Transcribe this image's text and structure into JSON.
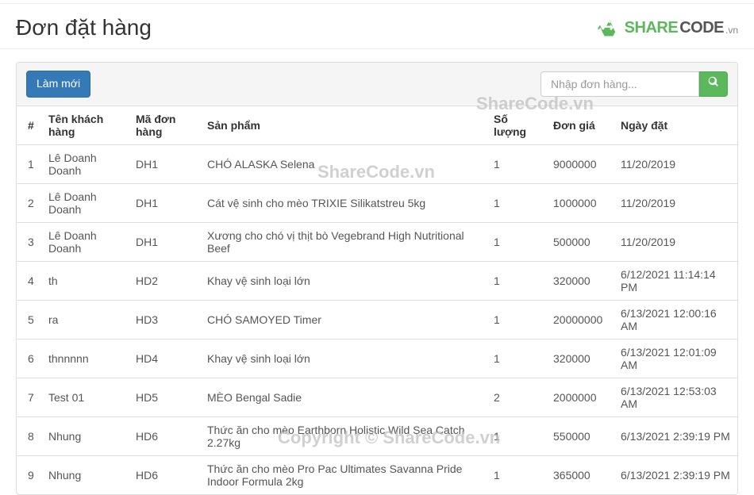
{
  "header": {
    "title": "Đơn đặt hàng",
    "logo": {
      "share": "SHARE",
      "code": "CODE",
      "vn": ".vn"
    }
  },
  "toolbar": {
    "refresh_label": "Làm mới",
    "search_placeholder": "Nhập đơn hàng..."
  },
  "table": {
    "headers": {
      "idx": "#",
      "customer": "Tên khách hàng",
      "order_code": "Mã đơn hàng",
      "product": "Sản phẩm",
      "qty": "Số lượng",
      "price": "Đơn giá",
      "date": "Ngày đặt"
    },
    "rows": [
      {
        "idx": "1",
        "customer": "Lê Doanh Doanh",
        "order_code": "DH1",
        "product": "CHÓ ALASKA Selena",
        "qty": "1",
        "price": "9000000",
        "date": "11/20/2019"
      },
      {
        "idx": "2",
        "customer": "Lê Doanh Doanh",
        "order_code": "DH1",
        "product": "Cát vệ sinh cho mèo TRIXIE Silikatstreu 5kg",
        "qty": "1",
        "price": "1000000",
        "date": "11/20/2019"
      },
      {
        "idx": "3",
        "customer": "Lê Doanh Doanh",
        "order_code": "DH1",
        "product": "Xương cho chó vị thịt bò Vegebrand High Nutritional Beef",
        "qty": "1",
        "price": "500000",
        "date": "11/20/2019"
      },
      {
        "idx": "4",
        "customer": "th",
        "order_code": "HD2",
        "product": "Khay vệ sinh loại lớn",
        "qty": "1",
        "price": "320000",
        "date": "6/12/2021 11:14:14 PM"
      },
      {
        "idx": "5",
        "customer": "ra",
        "order_code": "HD3",
        "product": "CHÓ SAMOYED Timer",
        "qty": "1",
        "price": "20000000",
        "date": "6/13/2021 12:00:16 AM"
      },
      {
        "idx": "6",
        "customer": "thnnnnn",
        "order_code": "HD4",
        "product": "Khay vệ sinh loại lớn",
        "qty": "1",
        "price": "320000",
        "date": "6/13/2021 12:01:09 AM"
      },
      {
        "idx": "7",
        "customer": "Test 01",
        "order_code": "HD5",
        "product": "MÈO Bengal Sadie",
        "qty": "2",
        "price": "2000000",
        "date": "6/13/2021 12:53:03 AM"
      },
      {
        "idx": "8",
        "customer": "Nhung",
        "order_code": "HD6",
        "product": "Thức ăn cho mèo Earthborn Holistic Wild Sea Catch 2.27kg",
        "qty": "1",
        "price": "550000",
        "date": "6/13/2021 2:39:19 PM"
      },
      {
        "idx": "9",
        "customer": "Nhung",
        "order_code": "HD6",
        "product": "Thức ăn cho mèo Pro Pac Ultimates Savanna Pride Indoor Formula 2kg",
        "qty": "1",
        "price": "365000",
        "date": "6/13/2021 2:39:19 PM"
      }
    ]
  },
  "watermarks": {
    "w1": "ShareCode.vn",
    "w2": "ShareCode.vn",
    "w3": "Copyright © ShareCode.vn"
  }
}
